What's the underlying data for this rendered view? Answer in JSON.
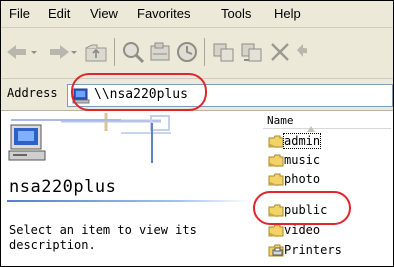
{
  "menu": [
    "File",
    "Edit",
    "View",
    "Favorites",
    "Tools",
    "Help"
  ],
  "toolbar": {
    "buttons": [
      "back-icon",
      "forward-icon",
      "up-folder-icon",
      "search-icon",
      "folders-icon",
      "history-icon",
      "copy-to-icon",
      "move-to-icon",
      "delete-icon",
      "undo-icon"
    ]
  },
  "address": {
    "label": "Address",
    "value": "\\\\nsa220plus"
  },
  "folder": {
    "title": "nsa220plus",
    "description": "Select an item to view its description."
  },
  "list": {
    "column_name": "Name",
    "items": [
      {
        "label": "admin",
        "icon": "shared-folder-icon"
      },
      {
        "label": "music",
        "icon": "shared-folder-icon"
      },
      {
        "label": "photo",
        "icon": "shared-folder-icon"
      },
      {
        "label": "public",
        "icon": "shared-folder-icon"
      },
      {
        "label": "video",
        "icon": "shared-folder-icon"
      },
      {
        "label": "Printers",
        "icon": "printers-folder-icon"
      }
    ]
  },
  "colors": {
    "chrome": "#ece9d8",
    "highlight": "#e0262c",
    "accent": "#5a7bd0"
  }
}
